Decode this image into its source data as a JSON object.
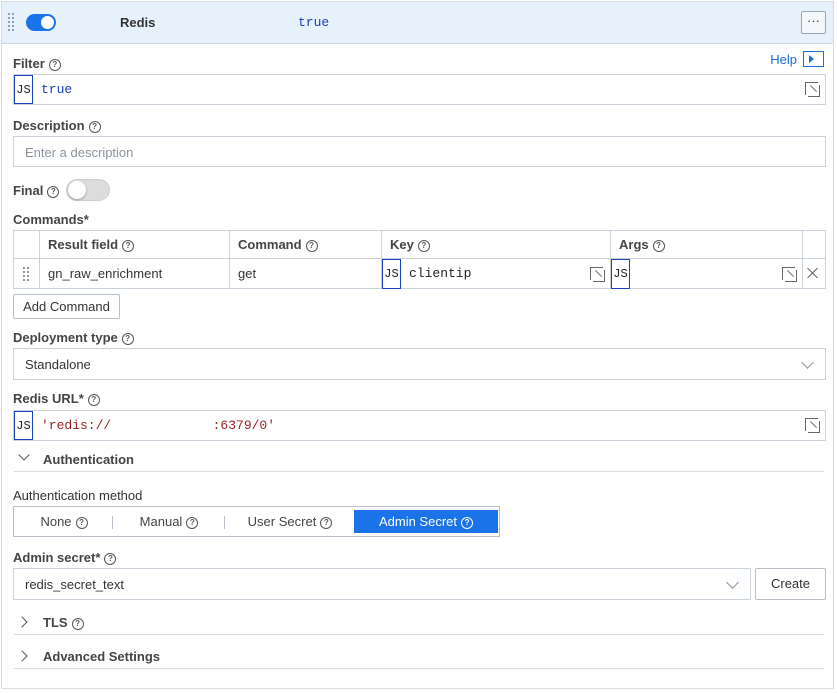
{
  "header": {
    "title": "Redis",
    "filter_expr": "true",
    "more_label": "···"
  },
  "help": {
    "label": "Help"
  },
  "filter": {
    "label": "Filter",
    "js_tag": "JS",
    "value": "true"
  },
  "description": {
    "label": "Description",
    "placeholder": "Enter a description"
  },
  "final": {
    "label": "Final"
  },
  "commands": {
    "label": "Commands*",
    "columns": [
      "Result field",
      "Command",
      "Key",
      "Args"
    ],
    "rows": [
      {
        "result_field": "gn_raw_enrichment",
        "command": "get",
        "key_js": "JS",
        "key": "clientip",
        "args_js": "JS",
        "args": ""
      }
    ],
    "add_label": "Add Command"
  },
  "deployment": {
    "label": "Deployment type",
    "value": "Standalone"
  },
  "redis_url": {
    "label": "Redis URL*",
    "js_tag": "JS",
    "value": "'redis://             :6379/0'"
  },
  "authentication": {
    "section_label": "Authentication",
    "method_label": "Authentication method",
    "methods": [
      "None",
      "Manual",
      "User Secret",
      "Admin Secret"
    ],
    "selected": "Admin Secret",
    "admin_secret_label": "Admin secret*",
    "admin_secret_value": "redis_secret_text",
    "create_label": "Create"
  },
  "tls": {
    "label": "TLS"
  },
  "advanced": {
    "label": "Advanced Settings"
  },
  "colors": {
    "accent": "#1a73e8",
    "header_bg": "#e6f1fb",
    "code_blue": "#1a3fb8",
    "code_red": "#9a1f1f"
  }
}
